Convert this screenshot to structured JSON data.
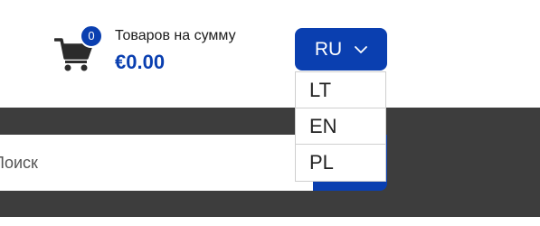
{
  "cart": {
    "count": "0",
    "caption": "Товаров на сумму",
    "total": "€0.00"
  },
  "language": {
    "current": "RU",
    "options": [
      "LT",
      "EN",
      "PL"
    ]
  },
  "search": {
    "placeholder": "Поиск"
  },
  "colors": {
    "accent": "#0a3fb0",
    "dark_band": "#3d3d3d",
    "cart_icon": "#2b2b2b"
  },
  "icons": {
    "cart": "shopping-cart-icon",
    "dropdown": "chevron-down-icon"
  }
}
